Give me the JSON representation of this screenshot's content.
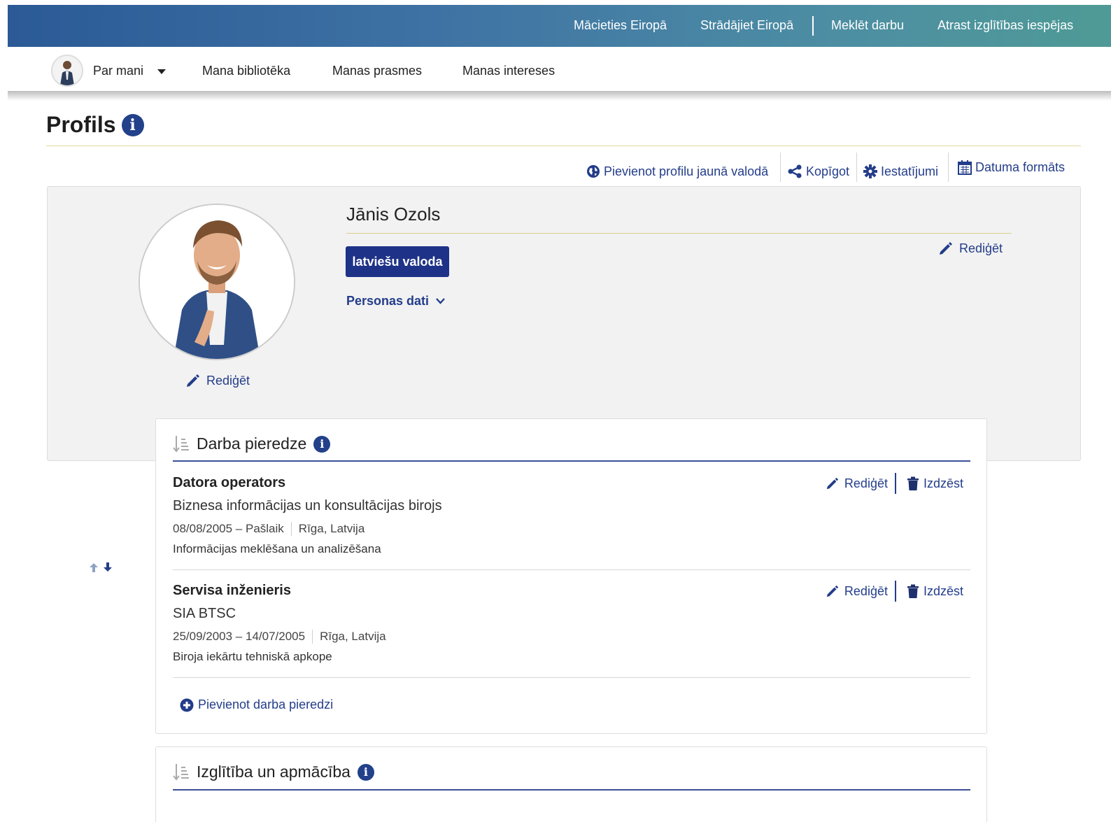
{
  "top_links": {
    "learn": "Mācieties Eiropā",
    "work": "Strādājiet Eiropā",
    "find_job": "Meklēt darbu",
    "find_learning": "Atrast izglītības iespējas"
  },
  "nav": {
    "about_me": "Par mani",
    "library": "Mana bibliotēka",
    "skills": "Manas prasmes",
    "interests": "Manas intereses"
  },
  "page": {
    "title": "Profils"
  },
  "actions": {
    "add_language": "Pievienot profilu jaunā valodā",
    "share": "Kopīgot",
    "settings": "Iestatījumi",
    "date_format": "Datuma formāts"
  },
  "profile": {
    "name": "Jānis Ozols",
    "language_button": "latviešu valoda",
    "personal_data": "Personas dati",
    "edit_label": "Rediģēt",
    "photo_edit_label": "Rediģēt"
  },
  "work_experience": {
    "heading": "Darba pieredze",
    "edit_label": "Rediģēt",
    "delete_label": "Izdzēst",
    "add_label": "Pievienot darba pieredzi",
    "items": [
      {
        "title": "Datora operators",
        "employer": "Biznesa informācijas un konsultācijas birojs",
        "dates": "08/08/2005 – Pašlaik",
        "location": "Rīga, Latvija",
        "description": "Informācijas meklēšana un analizēšana"
      },
      {
        "title": "Servisa inženieris",
        "employer": "SIA BTSC",
        "dates": "25/09/2003 – 14/07/2005",
        "location": "Rīga, Latvija",
        "description": "Biroja iekārtu tehniskā apkope"
      }
    ]
  },
  "education": {
    "heading": "Izglītība un apmācība"
  },
  "colors": {
    "brand_blue": "#1e3287",
    "link_blue": "#233d8a",
    "banner_start": "#2b5a96",
    "banner_end": "#4f9a96"
  }
}
